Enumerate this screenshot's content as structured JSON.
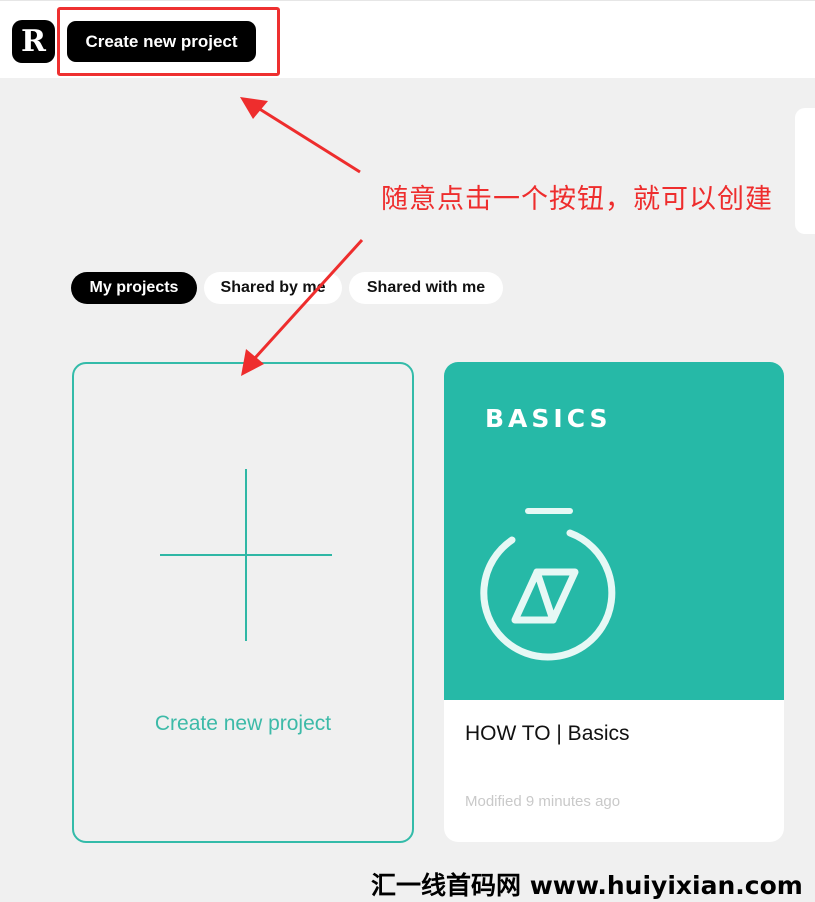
{
  "header": {
    "logo_text": "R",
    "create_button_label": "Create new project"
  },
  "annotation": {
    "text": "随意点击一个按钮，就可以创建",
    "color": "#ee2d2d"
  },
  "tabs": [
    {
      "label": "My projects",
      "active": true
    },
    {
      "label": "Shared by me",
      "active": false
    },
    {
      "label": "Shared with me",
      "active": false
    }
  ],
  "new_project_card": {
    "icon": "plus-icon",
    "label": "Create new project"
  },
  "projects": [
    {
      "thumbnail_label": "BASICS",
      "thumbnail_icon": "stopwatch-icon",
      "title": "HOW TO | Basics",
      "modified": "Modified 9 minutes ago"
    }
  ],
  "watermark": "汇一线首码网 www.huiyixian.com",
  "colors": {
    "accent": "#26b9a7",
    "highlight": "#ee3030",
    "background": "#f0f0f0"
  }
}
